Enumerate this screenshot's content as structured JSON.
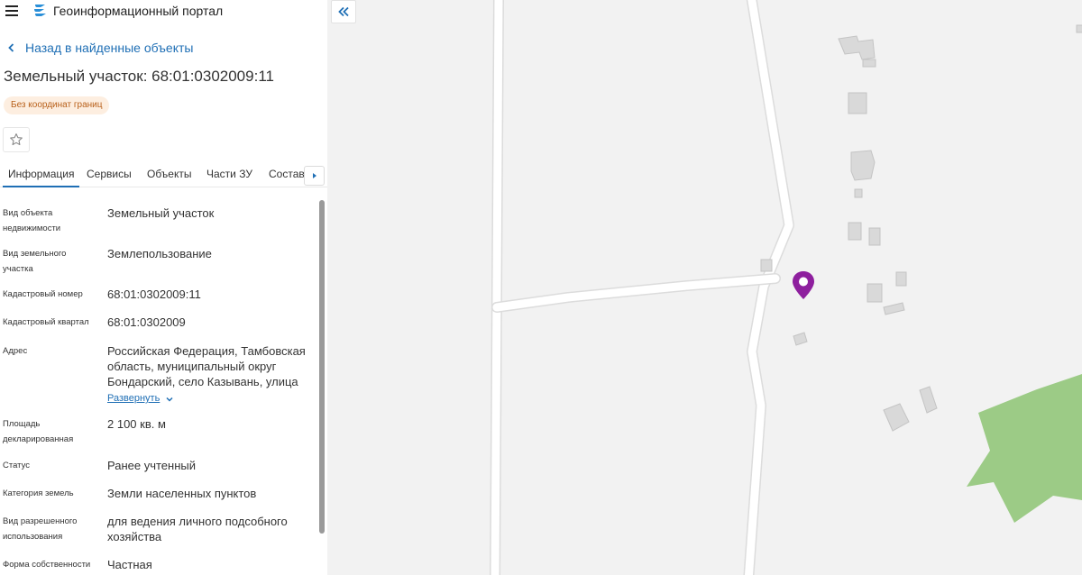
{
  "app": {
    "title": "Геоинформационный портал"
  },
  "nav": {
    "back_label": "Назад в найденные объекты"
  },
  "object": {
    "title": "Земельный участок: 68:01:0302009:11",
    "badge": "Без координат границ"
  },
  "tabs": [
    {
      "label": "Информация",
      "active": true
    },
    {
      "label": "Сервисы",
      "active": false
    },
    {
      "label": "Объекты",
      "active": false
    },
    {
      "label": "Части ЗУ",
      "active": false
    },
    {
      "label": "Состав",
      "active": false
    }
  ],
  "info": {
    "rows": [
      {
        "label": "Вид объекта недвижимости",
        "value": "Земельный участок"
      },
      {
        "label": "Вид земельного участка",
        "value": "Землепользование"
      },
      {
        "label": "Кадастровый номер",
        "value": "68:01:0302009:11"
      },
      {
        "label": "Кадастровый квартал",
        "value": "68:01:0302009"
      },
      {
        "label": "Адрес",
        "value": "Российская Федерация, Тамбовская область, муниципальный округ Бондарский, село Казывань, улица"
      },
      {
        "label": "Площадь декларированная",
        "value": "2 100 кв. м"
      },
      {
        "label": "Статус",
        "value": "Ранее учтенный"
      },
      {
        "label": "Категория земель",
        "value": "Земли населенных пунктов"
      },
      {
        "label": "Вид разрешенного использования",
        "value": "для ведения личного подсобного хозяйства"
      },
      {
        "label": "Форма собственности",
        "value": "Частная"
      }
    ],
    "expand_label": "Развернуть"
  },
  "icons": {
    "menu": "hamburger-icon",
    "logo": "portal-logo-icon",
    "back": "chevron-left-icon",
    "favorite": "star-icon",
    "tabs_next": "triangle-right-icon",
    "expand": "chevron-down-icon",
    "collapse": "double-chevron-left-icon",
    "marker": "map-pin-icon"
  },
  "colors": {
    "link": "#1f6fb5",
    "badge_text": "#b8601a",
    "badge_bg": "#fdeee0",
    "marker": "#8e1f9e",
    "map_bg": "#f2f2f2",
    "green_area": "#9ccb86"
  }
}
